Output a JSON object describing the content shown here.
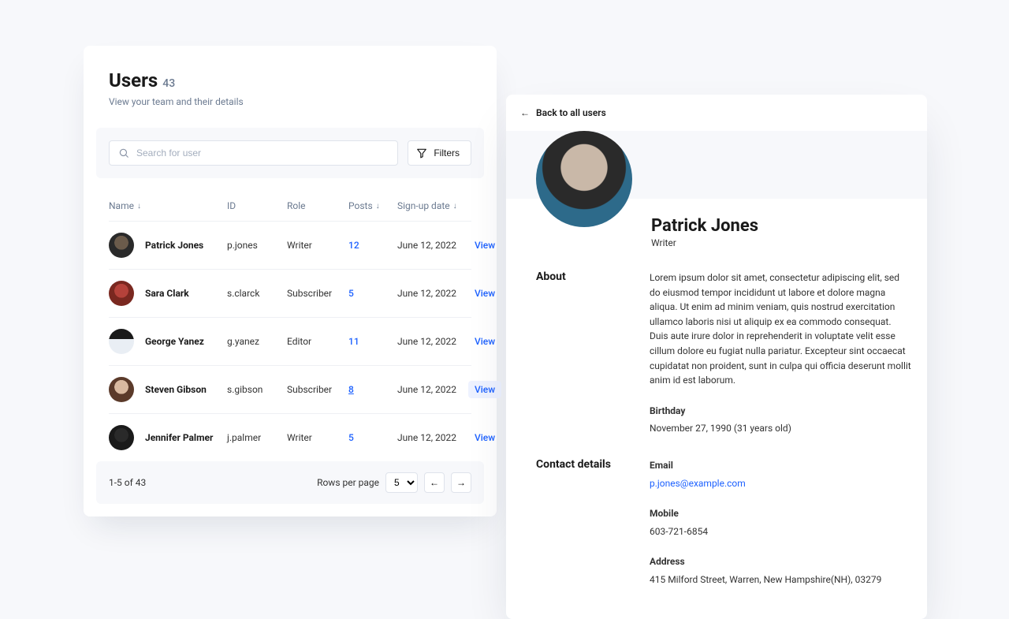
{
  "users_card": {
    "title": "Users",
    "count": "43",
    "subtitle": "View your team and their details",
    "search_placeholder": "Search for user",
    "filters_label": "Filters",
    "columns": {
      "name": "Name",
      "id": "ID",
      "role": "Role",
      "posts": "Posts",
      "signup": "Sign-up date"
    },
    "view_action": "View",
    "rows": [
      {
        "name": "Patrick Jones",
        "id": "p.jones",
        "role": "Writer",
        "posts": "12",
        "signup": "June 12, 2022"
      },
      {
        "name": "Sara Clark",
        "id": "s.clarck",
        "role": "Subscriber",
        "posts": "5",
        "signup": "June 12, 2022"
      },
      {
        "name": "George Yanez",
        "id": "g.yanez",
        "role": "Editor",
        "posts": "11",
        "signup": "June 12, 2022"
      },
      {
        "name": "Steven Gibson",
        "id": "s.gibson",
        "role": "Subscriber",
        "posts": "8",
        "signup": "June 12, 2022"
      },
      {
        "name": "Jennifer Palmer",
        "id": "j.palmer",
        "role": "Writer",
        "posts": "5",
        "signup": "June 12, 2022"
      }
    ],
    "pager": {
      "range": "1-5 of 43",
      "rows_label": "Rows per page",
      "rows_value": "5"
    }
  },
  "detail": {
    "back_label": "Back to all users",
    "name": "Patrick Jones",
    "role": "Writer",
    "about_heading": "About",
    "about_text": "Lorem ipsum dolor sit amet, consectetur adipiscing elit, sed do eiusmod tempor incididunt ut labore et dolore magna aliqua. Ut enim ad minim veniam, quis nostrud exercitation ullamco laboris nisi ut aliquip ex ea commodo consequat. Duis aute irure dolor in reprehenderit in voluptate velit esse cillum dolore eu fugiat nulla pariatur. Excepteur sint occaecat cupidatat non proident, sunt in culpa qui officia deserunt mollit anim id est laborum.",
    "birthday_label": "Birthday",
    "birthday_value": "November 27, 1990 (31 years old)",
    "contact_heading": "Contact details",
    "email_label": "Email",
    "email_value": "p.jones@example.com",
    "mobile_label": "Mobile",
    "mobile_value": "603-721-6854",
    "address_label": "Address",
    "address_value": "415 Milford Street, Warren, New Hampshire(NH), 03279"
  }
}
